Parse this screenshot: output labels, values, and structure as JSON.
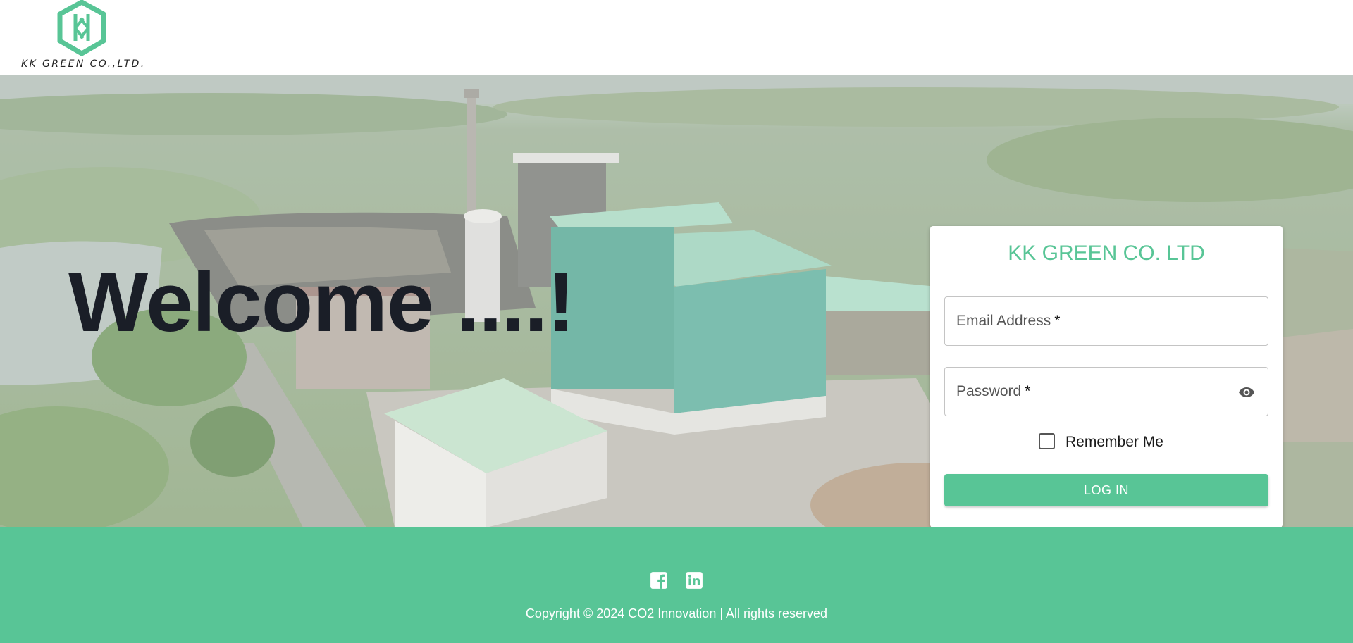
{
  "header": {
    "logo_text": "KK GREEN CO.,LTD.",
    "brand_color": "#58c596"
  },
  "hero": {
    "welcome_text": "Welcome ....!"
  },
  "login": {
    "title": "KK GREEN CO. LTD",
    "email_label": "Email Address",
    "password_label": "Password",
    "required_mark": "*",
    "remember_label": "Remember Me",
    "remember_checked": false,
    "submit_label": "LOG IN",
    "password_toggle_icon": "eye-icon"
  },
  "footer": {
    "social_icons": [
      "facebook-icon",
      "linkedin-icon"
    ],
    "copyright": "Copyright © 2024 CO2 Innovation | All rights reserved",
    "background_color": "#58c596"
  }
}
